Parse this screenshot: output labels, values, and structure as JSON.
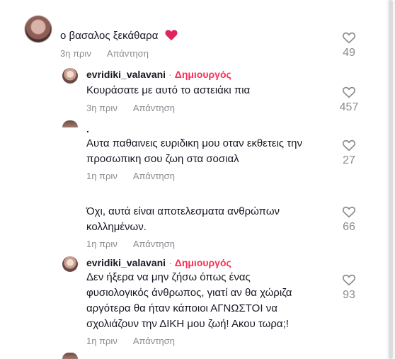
{
  "comments": [
    {
      "text": "ο βασαλος ξεκάθαρα",
      "emoji": "❤️",
      "time": "3η πριν",
      "reply": "Απάντηση",
      "likes": "49"
    },
    {
      "username": "evridiki_valavani",
      "separator": "·",
      "creator_badge": "Δημιουργός",
      "text": "Κουράσατε με αυτό το αστειάκι πια",
      "time": "3η πριν",
      "reply": "Απάντηση",
      "likes": "457"
    },
    {
      "username_partial": ".",
      "text_line1": "Αυτα παθαινεις ευριδικη μου οταν εκθετεις την",
      "text_line2": "προσωπικη σου ζωη στα σοσιαλ",
      "time": "1η πριν",
      "reply": "Απάντηση",
      "likes": "27"
    },
    {
      "text_line1": "Όχι, αυτά είναι αποτελεσματα ανθρώπων",
      "text_line2": "κολλημένων.",
      "time": "1η πριν",
      "reply": "Απάντηση",
      "likes": "66"
    },
    {
      "username": "evridiki_valavani",
      "separator": "·",
      "creator_badge": "Δημιουργός",
      "text_line1": "Δεν ήξερα να μην ζήσω όπως ένας",
      "text_line2": "φυσιολογικός άνθρωπος, γιατί αν θα χώριζα",
      "text_line3": "αργότερα θα ήταν κάποιοι ΑΓΝΩΣΤΟΙ να",
      "text_line4": "σχολιάζουν την ΔΙΚΗ μου ζωή! Ακου τωρα;!",
      "time": "1η πριν",
      "reply": "Απάντηση",
      "likes": "93"
    }
  ],
  "icons": {
    "like": "heart-outline-icon",
    "emoji": "red-heart-icon"
  },
  "colors": {
    "creator": "#fe2c55",
    "meta": "#8a8b91",
    "text": "#161823"
  }
}
